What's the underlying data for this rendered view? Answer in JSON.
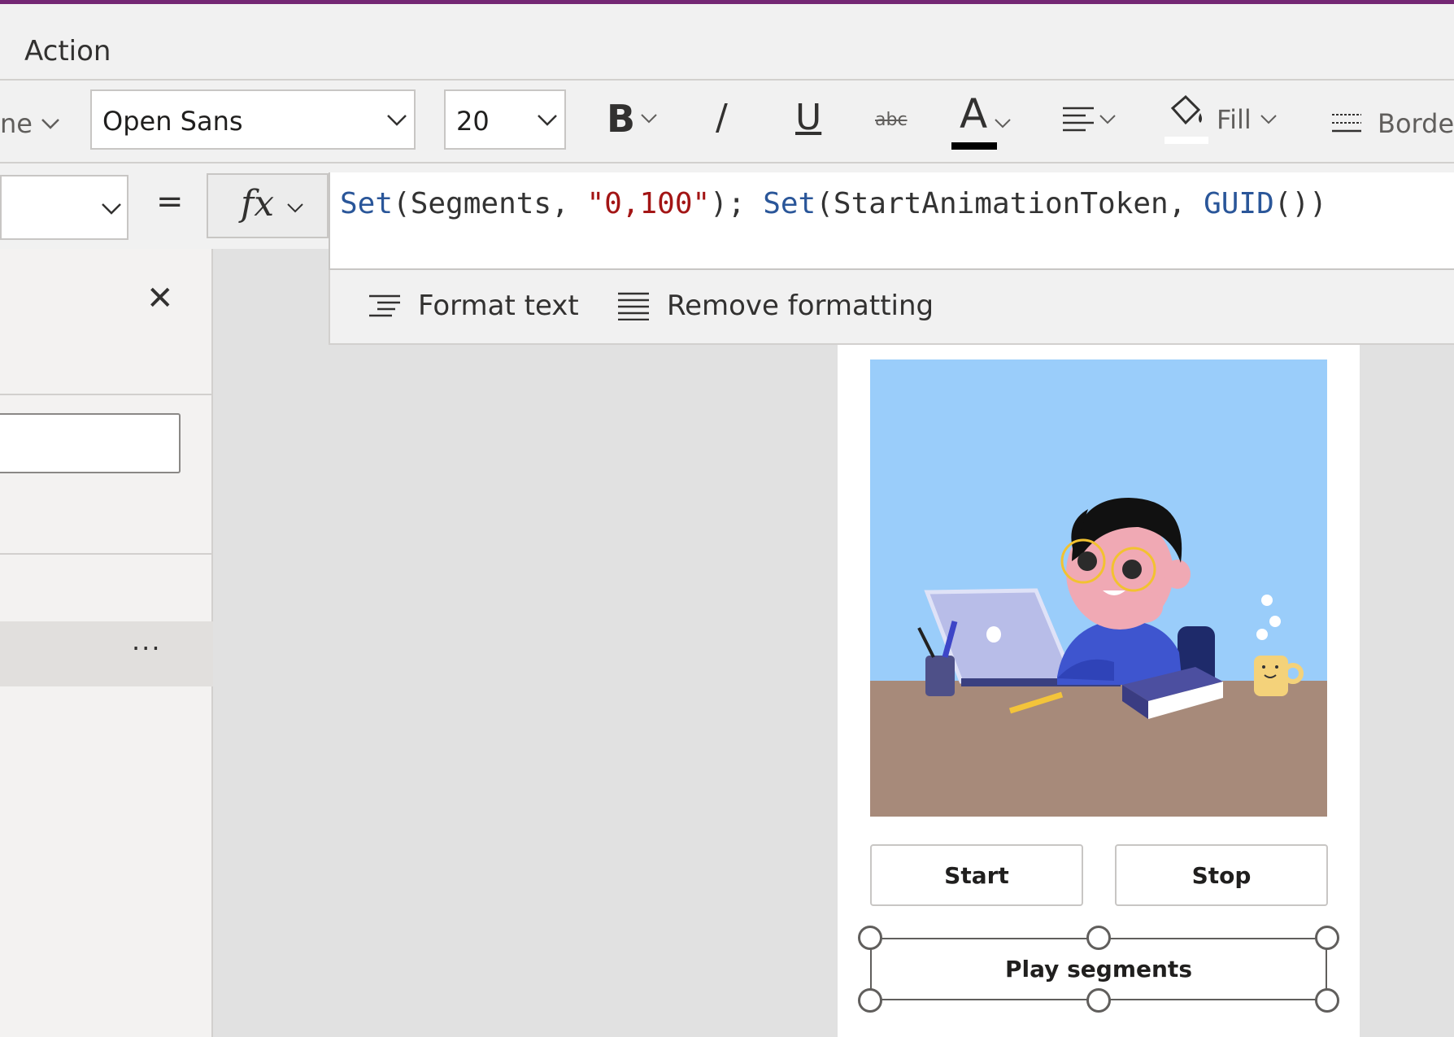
{
  "menu": {
    "active_tab": "Action"
  },
  "ribbon": {
    "property_fragment": "ne",
    "font_family": "Open Sans",
    "font_size": "20",
    "bold_label": "B",
    "italic_label": "/",
    "underline_label": "U",
    "strikethrough_label": "abc",
    "font_color_label": "A",
    "fill_label": "Fill",
    "border_label": "Borde",
    "font_color_value": "#000000",
    "fill_color_value": "#ffffff"
  },
  "formula_bar": {
    "property_value": "",
    "equals": "=",
    "fx_label": "fx",
    "tokens": [
      {
        "text": "Set",
        "kind": "fn"
      },
      {
        "text": "(Segments, ",
        "kind": "plain"
      },
      {
        "text": "\"0,100\"",
        "kind": "str"
      },
      {
        "text": "); ",
        "kind": "plain"
      },
      {
        "text": "Set",
        "kind": "fn"
      },
      {
        "text": "(StartAnimationToken, ",
        "kind": "plain"
      },
      {
        "text": "GUID",
        "kind": "fn"
      },
      {
        "text": "())",
        "kind": "plain"
      }
    ]
  },
  "format_bar": {
    "format_text_label": "Format text",
    "remove_formatting_label": "Remove formatting"
  },
  "left_panel": {
    "close_label": "✕",
    "input_value": "",
    "more_label": "···"
  },
  "app": {
    "start_label": "Start",
    "stop_label": "Stop",
    "play_label": "Play segments"
  },
  "colors": {
    "accent": "#742774",
    "function_token": "#2a5699",
    "string_token": "#a31515",
    "sky": "#9acdfa",
    "desk": "#a78a7a"
  }
}
